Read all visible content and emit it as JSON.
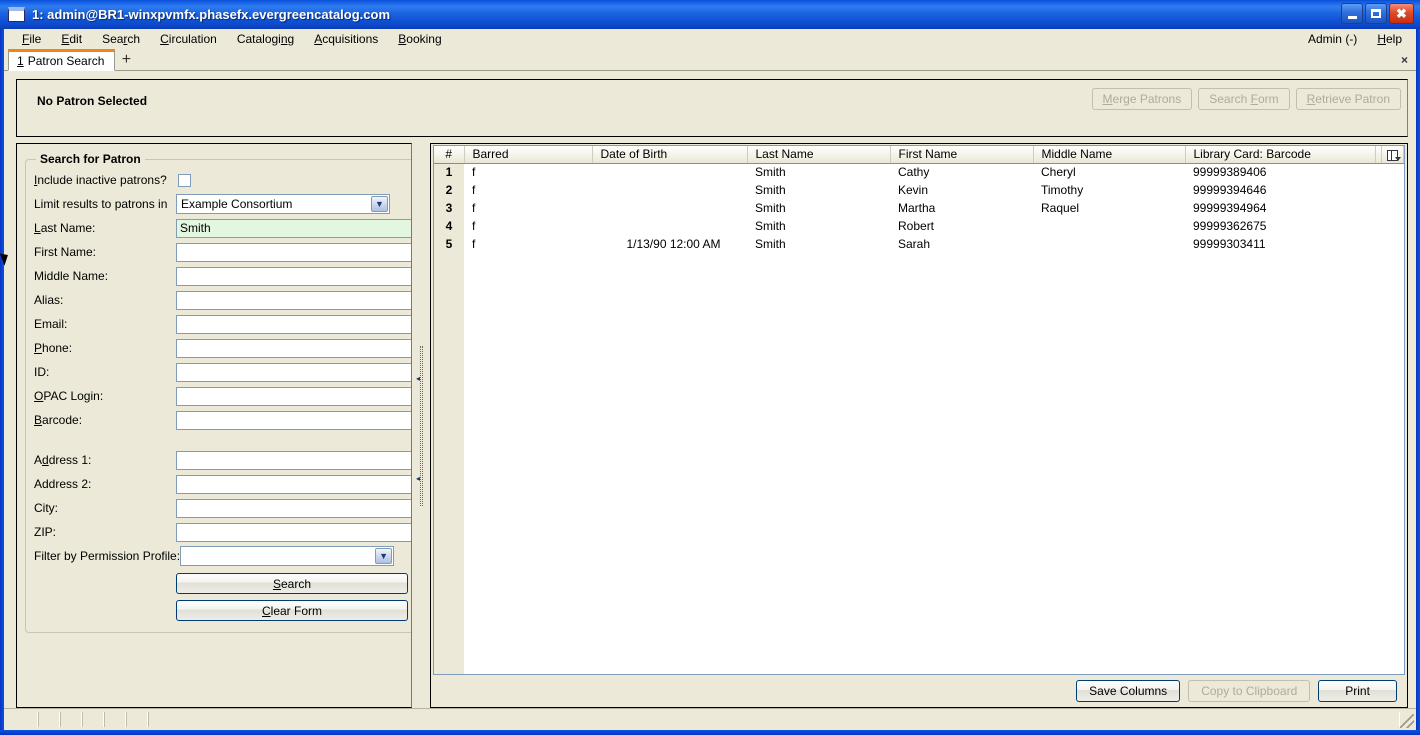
{
  "window": {
    "title": "1: admin@BR1-winxpvmfx.phasefx.evergreencatalog.com",
    "app_icon": "window-icon",
    "minimize_label": "Minimize",
    "maximize_label": "Maximize",
    "close_label": "Close"
  },
  "menubar": {
    "items": [
      {
        "label": "File",
        "mnemonic": "F"
      },
      {
        "label": "Edit",
        "mnemonic": "E"
      },
      {
        "label": "Search",
        "mnemonic": "r"
      },
      {
        "label": "Circulation",
        "mnemonic": "C"
      },
      {
        "label": "Cataloging",
        "mnemonic": "n"
      },
      {
        "label": "Acquisitions",
        "mnemonic": "A"
      },
      {
        "label": "Booking",
        "mnemonic": "B"
      }
    ],
    "right_items": [
      {
        "label": "Admin (-)"
      },
      {
        "label": "Help",
        "mnemonic": "H"
      }
    ]
  },
  "tabbar": {
    "active_tab_index": "1",
    "active_tab_label": "Patron Search",
    "new_tab_label": "+",
    "close_tab_label": "×"
  },
  "patron_header": {
    "status": "No Patron Selected",
    "buttons": [
      {
        "label": "Merge Patrons",
        "enabled": false
      },
      {
        "label": "Search Form",
        "enabled": false
      },
      {
        "label": "Retrieve Patron",
        "enabled": false
      }
    ]
  },
  "search_form": {
    "legend": "Search for Patron",
    "include_inactive_label": "Include inactive patrons?",
    "include_inactive_checked": false,
    "limit_results_label": "Limit results to patrons in",
    "limit_results_value": "Example Consortium",
    "fields": [
      {
        "label": "Last Name:",
        "value": "Smith",
        "focused": true
      },
      {
        "label": "First Name:",
        "value": "",
        "focused": false
      },
      {
        "label": "Middle Name:",
        "value": "",
        "focused": false
      },
      {
        "label": "Alias:",
        "value": "",
        "focused": false
      },
      {
        "label": "Email:",
        "value": "",
        "focused": false
      },
      {
        "label": "Phone:",
        "value": "",
        "focused": false
      },
      {
        "label": "ID:",
        "value": "",
        "focused": false
      },
      {
        "label": "OPAC Login:",
        "value": "",
        "focused": false
      },
      {
        "label": "Barcode:",
        "value": "",
        "focused": false
      }
    ],
    "address_fields": [
      {
        "label": "Address 1:",
        "value": ""
      },
      {
        "label": "Address 2:",
        "value": ""
      },
      {
        "label": "City:",
        "value": ""
      },
      {
        "label": "ZIP:",
        "value": ""
      }
    ],
    "permission_profile_label": "Filter by Permission Profile:",
    "permission_profile_value": "",
    "search_button": "Search",
    "clear_button": "Clear Form"
  },
  "results": {
    "columns": [
      "#",
      "Barred",
      "Date of Birth",
      "Last Name",
      "First Name",
      "Middle Name",
      "Library Card: Barcode"
    ],
    "column_picker_icon": "column-picker-icon",
    "rows": [
      {
        "num": "1",
        "barred": "f",
        "dob": "",
        "last": "Smith",
        "first": "Cathy",
        "middle": "Cheryl",
        "barcode": "99999389406"
      },
      {
        "num": "2",
        "barred": "f",
        "dob": "",
        "last": "Smith",
        "first": "Kevin",
        "middle": "Timothy",
        "barcode": "99999394646"
      },
      {
        "num": "3",
        "barred": "f",
        "dob": "",
        "last": "Smith",
        "first": "Martha",
        "middle": "Raquel",
        "barcode": "99999394964"
      },
      {
        "num": "4",
        "barred": "f",
        "dob": "",
        "last": "Smith",
        "first": "Robert",
        "middle": "",
        "barcode": "99999362675"
      },
      {
        "num": "5",
        "barred": "f",
        "dob": "1/13/90 12:00 AM",
        "last": "Smith",
        "first": "Sarah",
        "middle": "",
        "barcode": "99999303411"
      }
    ],
    "footer_buttons": [
      {
        "label": "Save Columns",
        "enabled": true
      },
      {
        "label": "Copy to Clipboard",
        "enabled": false
      },
      {
        "label": "Print",
        "enabled": true
      }
    ]
  },
  "colors": {
    "titlebar_blue": "#1560e8",
    "window_border": "#0831c9",
    "chrome_beige": "#ece9d8",
    "tab_accent_orange": "#f0861b",
    "field_border": "#7f9db9",
    "focused_field_green": "#e3f6e0",
    "disabled_text": "#b0ab99"
  }
}
